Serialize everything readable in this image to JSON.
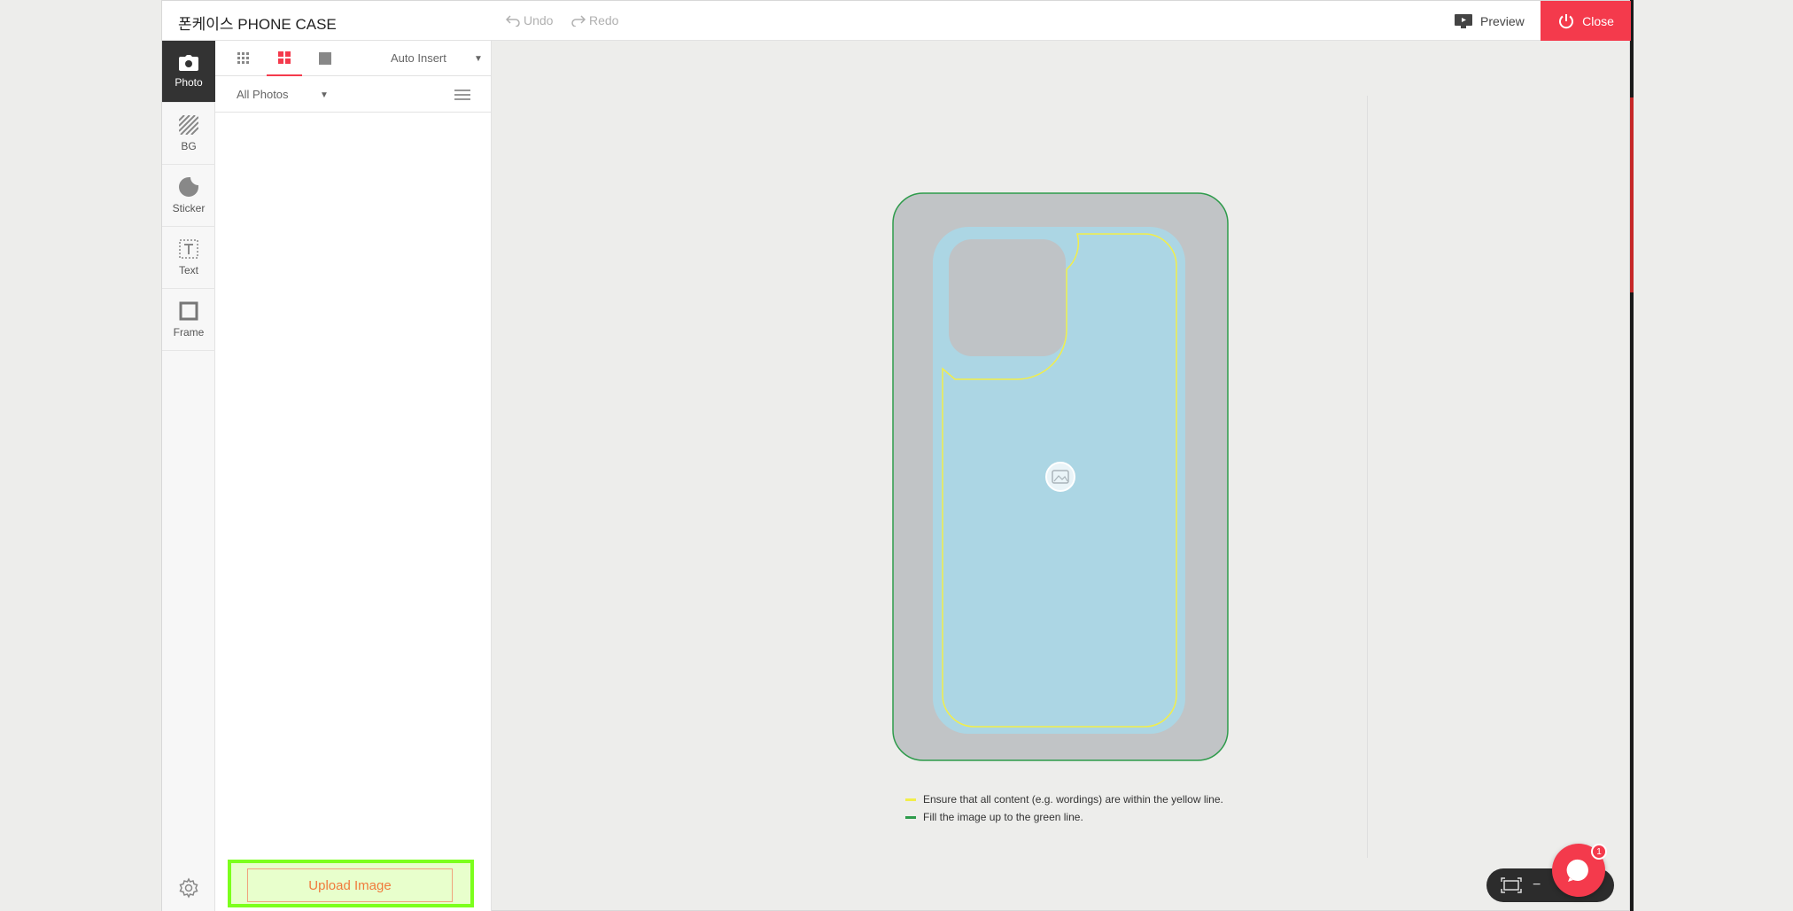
{
  "app": {
    "title": "폰케이스 PHONE CASE",
    "undo_label": "Undo",
    "redo_label": "Redo",
    "preview_label": "Preview",
    "close_label": "Close"
  },
  "sidebar": {
    "items": [
      {
        "label": "Photo",
        "icon": "camera-icon",
        "active": true
      },
      {
        "label": "BG",
        "icon": "hatch-icon",
        "active": false
      },
      {
        "label": "Sticker",
        "icon": "sticker-icon",
        "active": false
      },
      {
        "label": "Text",
        "icon": "text-icon",
        "active": false
      },
      {
        "label": "Frame",
        "icon": "frame-icon",
        "active": false
      }
    ],
    "settings_icon": "gear-icon"
  },
  "panel": {
    "view_tabs": [
      "grid-small-icon",
      "grid-large-icon",
      "single-icon"
    ],
    "active_view_tab": 1,
    "auto_insert_label": "Auto Insert",
    "filter_label": "All Photos",
    "upload_label": "Upload Image"
  },
  "canvas": {
    "legend": [
      {
        "text": "Ensure that all content (e.g. wordings) are within the yellow line.",
        "color": "#f2ee4a"
      },
      {
        "text": "Fill the image up to the green line.",
        "color": "#2e9b4b"
      }
    ],
    "placeholder_icon": "image-icon"
  },
  "chat": {
    "badge_count": "1",
    "icon": "chat-icon"
  },
  "zoom": {
    "fit_icon": "fit-screen-icon",
    "minus_label": "−"
  },
  "colors": {
    "accent": "#f43a4c",
    "upload_highlight": "#7cff1d",
    "case_fill": "#acd6e4",
    "case_bleed": "#c1c4c6",
    "safe_line": "#f2ee4a",
    "bleed_line": "#2e9b4b"
  }
}
